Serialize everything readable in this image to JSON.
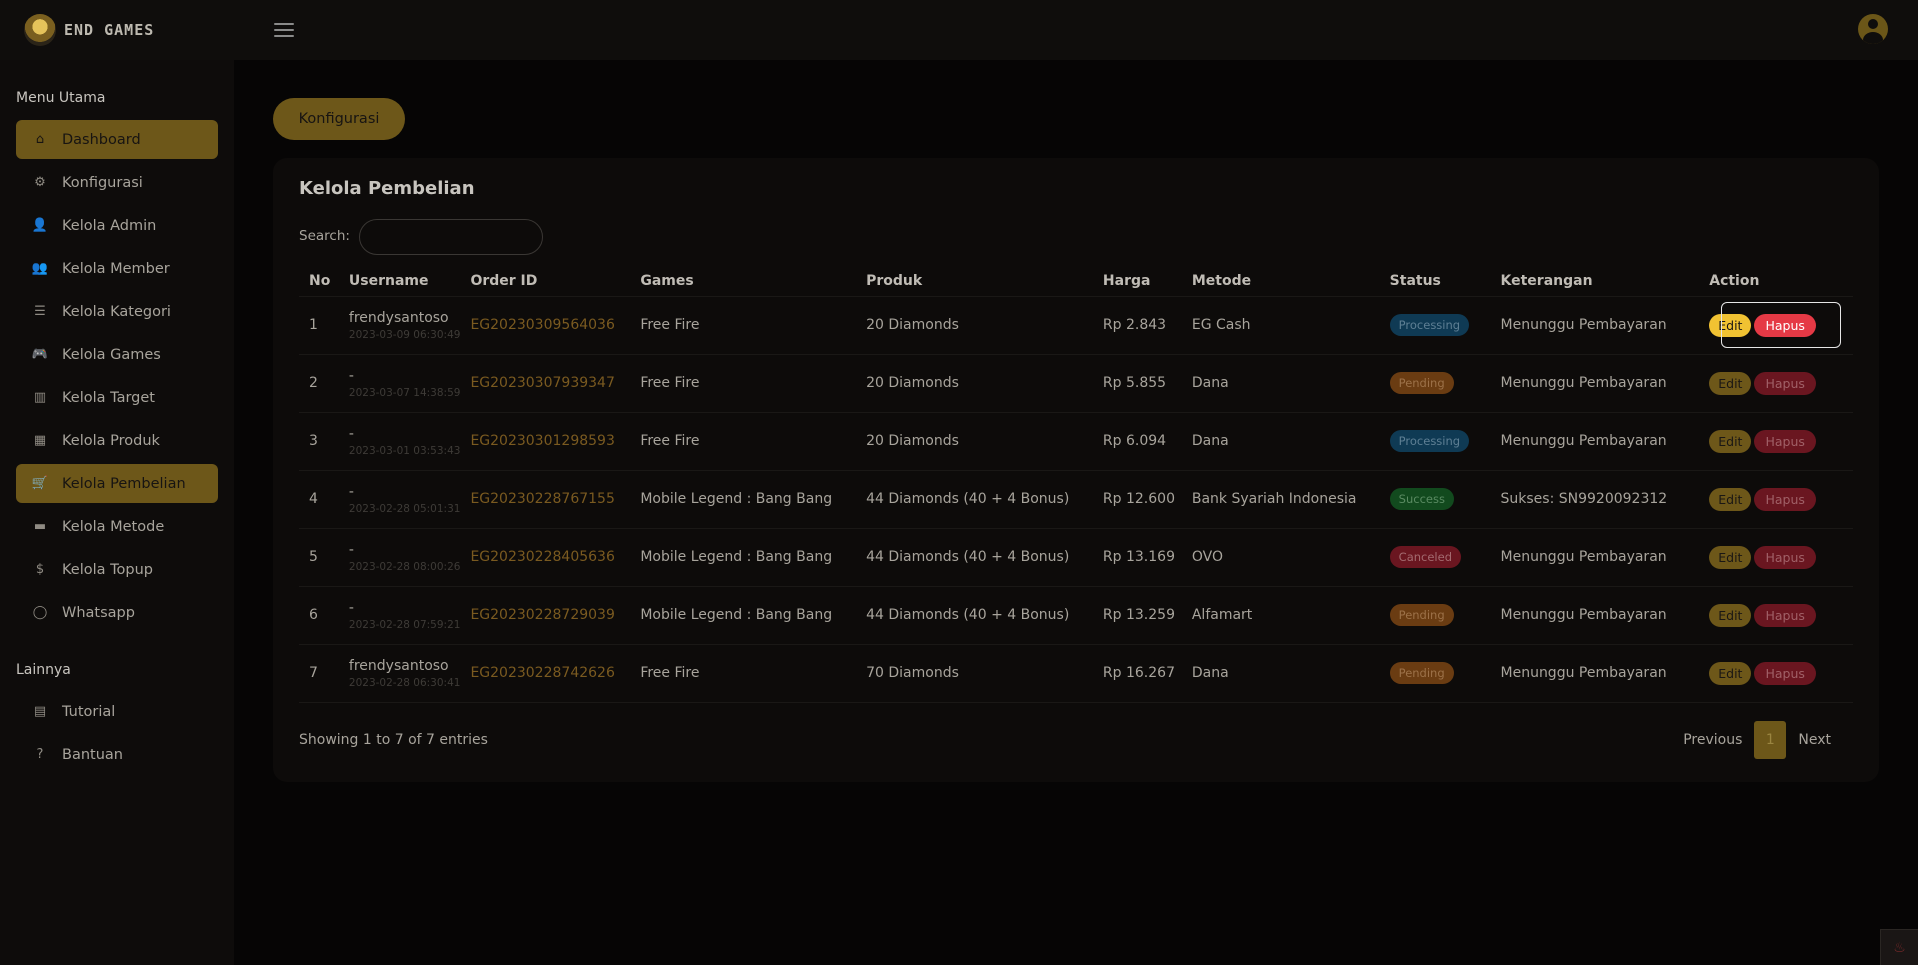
{
  "brand": {
    "name": "END GAMES"
  },
  "sidebar": {
    "section_main": "Menu Utama",
    "section_other": "Lainnya",
    "items": [
      {
        "label": "Dashboard",
        "icon": "home-icon",
        "glyph": "⌂",
        "active": true
      },
      {
        "label": "Konfigurasi",
        "icon": "gear-icon",
        "glyph": "⚙",
        "active": false
      },
      {
        "label": "Kelola Admin",
        "icon": "user-gear-icon",
        "glyph": "👤",
        "active": false
      },
      {
        "label": "Kelola Member",
        "icon": "users-icon",
        "glyph": "👥",
        "active": false
      },
      {
        "label": "Kelola Kategori",
        "icon": "list-icon",
        "glyph": "☰",
        "active": false
      },
      {
        "label": "Kelola Games",
        "icon": "gamepad-icon",
        "glyph": "🎮",
        "active": false
      },
      {
        "label": "Kelola Target",
        "icon": "columns-icon",
        "glyph": "▥",
        "active": false
      },
      {
        "label": "Kelola Produk",
        "icon": "calendar-icon",
        "glyph": "▦",
        "active": false
      },
      {
        "label": "Kelola Pembelian",
        "icon": "basket-icon",
        "glyph": "🛒",
        "active": true
      },
      {
        "label": "Kelola Metode",
        "icon": "credit-card-icon",
        "glyph": "▬",
        "active": false
      },
      {
        "label": "Kelola Topup",
        "icon": "dollar-icon",
        "glyph": "$",
        "active": false
      },
      {
        "label": "Whatsapp",
        "icon": "whatsapp-icon",
        "glyph": "◯",
        "active": false
      }
    ],
    "other_items": [
      {
        "label": "Tutorial",
        "icon": "book-icon",
        "glyph": "▤"
      },
      {
        "label": "Bantuan",
        "icon": "question-icon",
        "glyph": "?"
      }
    ]
  },
  "main": {
    "config_button": "Konfigurasi",
    "card_title": "Kelola Pembelian",
    "search_label": "Search:",
    "search_value": "",
    "columns": [
      "No",
      "Username",
      "Order ID",
      "Games",
      "Produk",
      "Harga",
      "Metode",
      "Status",
      "Keterangan",
      "Action"
    ],
    "rows": [
      {
        "no": "1",
        "username": "frendysantoso",
        "date": "2023-03-09 06:30:49",
        "order_id": "EG20230309564036",
        "game": "Free Fire",
        "product": "20 Diamonds",
        "price": "Rp 2.843",
        "method": "EG Cash",
        "status": "Processing",
        "status_class": "processing",
        "note": "Menunggu Pembayaran",
        "focused": true
      },
      {
        "no": "2",
        "username": "-",
        "date": "2023-03-07 14:38:59",
        "order_id": "EG20230307939347",
        "game": "Free Fire",
        "product": "20 Diamonds",
        "price": "Rp 5.855",
        "method": "Dana",
        "status": "Pending",
        "status_class": "pending",
        "note": "Menunggu Pembayaran",
        "focused": false
      },
      {
        "no": "3",
        "username": "-",
        "date": "2023-03-01 03:53:43",
        "order_id": "EG20230301298593",
        "game": "Free Fire",
        "product": "20 Diamonds",
        "price": "Rp 6.094",
        "method": "Dana",
        "status": "Processing",
        "status_class": "processing",
        "note": "Menunggu Pembayaran",
        "focused": false
      },
      {
        "no": "4",
        "username": "-",
        "date": "2023-02-28 05:01:31",
        "order_id": "EG20230228767155",
        "game": "Mobile Legend : Bang Bang",
        "product": "44 Diamonds (40 + 4 Bonus)",
        "price": "Rp 12.600",
        "method": "Bank Syariah Indonesia",
        "status": "Success",
        "status_class": "success",
        "note": "Sukses: SN9920092312",
        "focused": false
      },
      {
        "no": "5",
        "username": "-",
        "date": "2023-02-28 08:00:26",
        "order_id": "EG20230228405636",
        "game": "Mobile Legend : Bang Bang",
        "product": "44 Diamonds (40 + 4 Bonus)",
        "price": "Rp 13.169",
        "method": "OVO",
        "status": "Canceled",
        "status_class": "canceled",
        "note": "Menunggu Pembayaran",
        "focused": false
      },
      {
        "no": "6",
        "username": "-",
        "date": "2023-02-28 07:59:21",
        "order_id": "EG20230228729039",
        "game": "Mobile Legend : Bang Bang",
        "product": "44 Diamonds (40 + 4 Bonus)",
        "price": "Rp 13.259",
        "method": "Alfamart",
        "status": "Pending",
        "status_class": "pending",
        "note": "Menunggu Pembayaran",
        "focused": false
      },
      {
        "no": "7",
        "username": "frendysantoso",
        "date": "2023-02-28 06:30:41",
        "order_id": "EG20230228742626",
        "game": "Free Fire",
        "product": "70 Diamonds",
        "price": "Rp 16.267",
        "method": "Dana",
        "status": "Pending",
        "status_class": "pending",
        "note": "Menunggu Pembayaran",
        "focused": false
      }
    ],
    "edit_label": "Edit",
    "delete_label": "Hapus",
    "showing_text": "Showing 1 to 7 of 7 entries",
    "pagination": {
      "previous": "Previous",
      "current": "1",
      "next": "Next"
    }
  },
  "colors": {
    "accent": "#6d5719",
    "edit_active": "#f1c232",
    "delete_active": "#e53945"
  }
}
